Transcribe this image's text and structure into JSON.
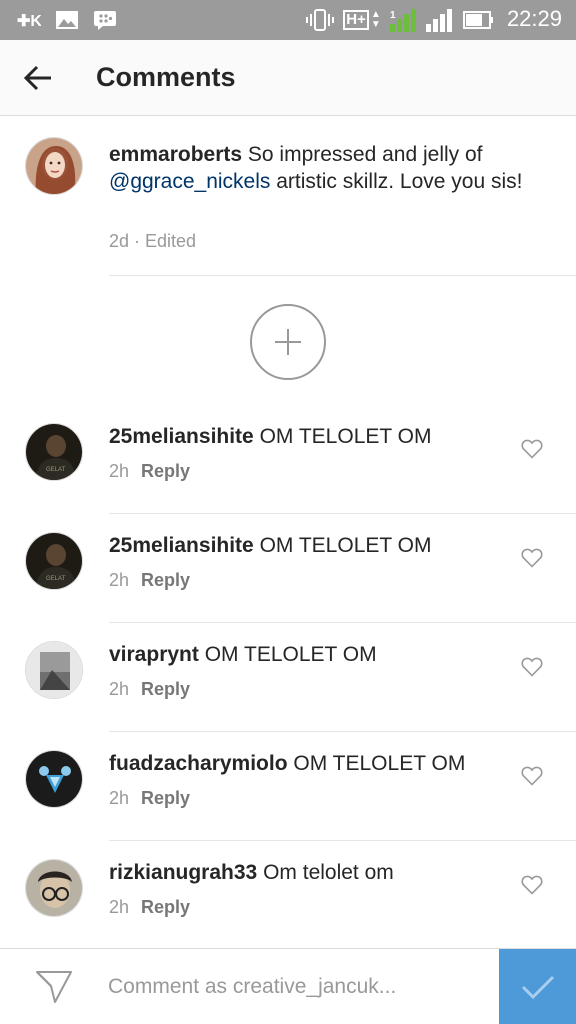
{
  "status_bar": {
    "time": "22:29",
    "vk_icon": "vk-icon",
    "network": "H+",
    "sim2": "2"
  },
  "header": {
    "title": "Comments",
    "back_icon": "back-arrow-icon"
  },
  "caption": {
    "username": "emmaroberts",
    "text_before": " So impressed and jelly of ",
    "mention": "@ggrace_nickels",
    "text_after": " artistic skillz. Love you sis!",
    "meta": "2d · Edited"
  },
  "load_more_icon": "plus-icon",
  "comments": [
    {
      "username": "25meliansihite",
      "text": " OM TELOLET OM",
      "time": "2h",
      "reply": "Reply"
    },
    {
      "username": "25meliansihite",
      "text": " OM TELOLET OM",
      "time": "2h",
      "reply": "Reply"
    },
    {
      "username": "viraprynt",
      "text": " OM TELOLET OM",
      "time": "2h",
      "reply": "Reply"
    },
    {
      "username": "fuadzacharymiolo",
      "text": " OM TELOLET OM",
      "time": "2h",
      "reply": "Reply"
    },
    {
      "username": "rizkianugrah33",
      "text": " Om telolet om",
      "time": "2h",
      "reply": "Reply"
    }
  ],
  "composer": {
    "placeholder": "Comment as creative_jancuk...",
    "post_color": "#4e9ad8"
  },
  "colors": {
    "mention": "#003569",
    "status_bar": "#9b9b9b",
    "signal_green": "#6bbf3a"
  }
}
